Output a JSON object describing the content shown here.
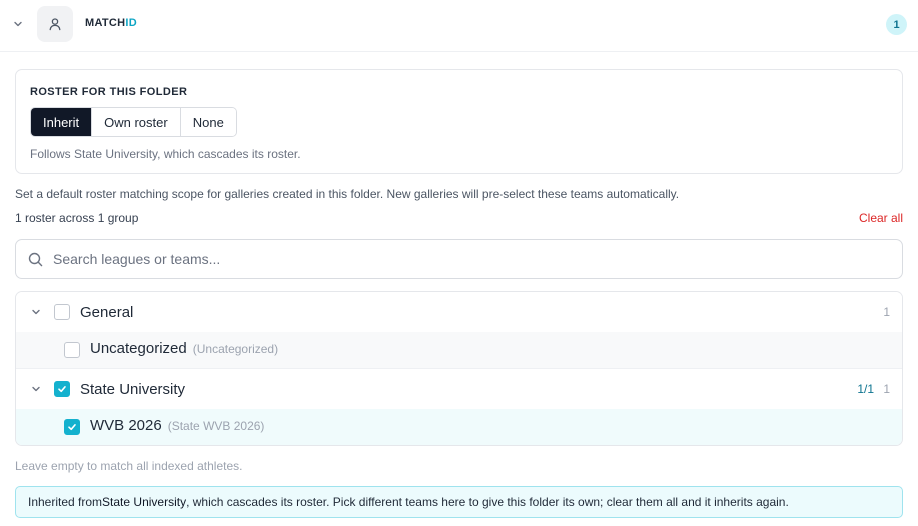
{
  "header": {
    "brand_main": "MATCH",
    "brand_accent": "ID",
    "badge_count": "1"
  },
  "roster": {
    "title": "ROSTER FOR THIS FOLDER",
    "options": [
      "Inherit",
      "Own roster",
      "None"
    ],
    "selected": "Inherit",
    "description": "Follows State University, which cascades its roster."
  },
  "scope": {
    "description": "Set a default roster matching scope for galleries created in this folder. New galleries will pre-select these teams automatically.",
    "summary": "1 roster across 1 group",
    "clear_label": "Clear all"
  },
  "search": {
    "placeholder": "Search leagues or teams..."
  },
  "groups": [
    {
      "name": "General",
      "count": "1",
      "ratio": "",
      "checked": false,
      "items": [
        {
          "name": "Uncategorized",
          "sub": "(Uncategorized)",
          "checked": false
        }
      ]
    },
    {
      "name": "State University",
      "count": "1",
      "ratio": "1/1",
      "checked": true,
      "items": [
        {
          "name": "WVB 2026",
          "sub": "(State WVB 2026)",
          "checked": true
        }
      ]
    }
  ],
  "hint": "Leave empty to match all indexed athletes.",
  "banner": {
    "prefix": "Inherited from ",
    "source": "State University",
    "suffix": ", which cascades its roster. Pick different teams here to give this folder its own; clear them all and it inherits again."
  },
  "colors": {
    "accent": "#14b1ce",
    "danger": "#dc2626",
    "active_segment": "#111827"
  }
}
